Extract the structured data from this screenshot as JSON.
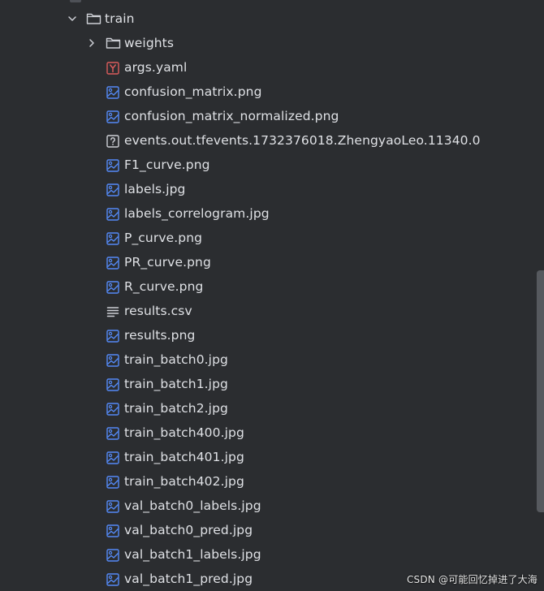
{
  "tree": {
    "root_folder": {
      "name": "train",
      "expanded": true,
      "icon": "folder-icon"
    },
    "children": [
      {
        "name": "weights",
        "type": "folder",
        "icon": "folder-icon",
        "collapsed": true
      },
      {
        "name": "args.yaml",
        "type": "yaml",
        "icon": "yaml-file-icon"
      },
      {
        "name": "confusion_matrix.png",
        "type": "image",
        "icon": "image-file-icon"
      },
      {
        "name": "confusion_matrix_normalized.png",
        "type": "image",
        "icon": "image-file-icon"
      },
      {
        "name": "events.out.tfevents.1732376018.ZhengyaoLeo.11340.0",
        "type": "unknown",
        "icon": "unknown-file-icon"
      },
      {
        "name": "F1_curve.png",
        "type": "image",
        "icon": "image-file-icon"
      },
      {
        "name": "labels.jpg",
        "type": "image",
        "icon": "image-file-icon"
      },
      {
        "name": "labels_correlogram.jpg",
        "type": "image",
        "icon": "image-file-icon"
      },
      {
        "name": "P_curve.png",
        "type": "image",
        "icon": "image-file-icon"
      },
      {
        "name": "PR_curve.png",
        "type": "image",
        "icon": "image-file-icon"
      },
      {
        "name": "R_curve.png",
        "type": "image",
        "icon": "image-file-icon"
      },
      {
        "name": "results.csv",
        "type": "text",
        "icon": "text-file-icon"
      },
      {
        "name": "results.png",
        "type": "image",
        "icon": "image-file-icon"
      },
      {
        "name": "train_batch0.jpg",
        "type": "image",
        "icon": "image-file-icon"
      },
      {
        "name": "train_batch1.jpg",
        "type": "image",
        "icon": "image-file-icon"
      },
      {
        "name": "train_batch2.jpg",
        "type": "image",
        "icon": "image-file-icon"
      },
      {
        "name": "train_batch400.jpg",
        "type": "image",
        "icon": "image-file-icon"
      },
      {
        "name": "train_batch401.jpg",
        "type": "image",
        "icon": "image-file-icon"
      },
      {
        "name": "train_batch402.jpg",
        "type": "image",
        "icon": "image-file-icon"
      },
      {
        "name": "val_batch0_labels.jpg",
        "type": "image",
        "icon": "image-file-icon"
      },
      {
        "name": "val_batch0_pred.jpg",
        "type": "image",
        "icon": "image-file-icon"
      },
      {
        "name": "val_batch1_labels.jpg",
        "type": "image",
        "icon": "image-file-icon"
      },
      {
        "name": "val_batch1_pred.jpg",
        "type": "image",
        "icon": "image-file-icon"
      }
    ]
  },
  "watermark": "CSDN @可能回忆掉进了大海",
  "colors": {
    "background": "#2b2d30",
    "text": "#dfe1e5",
    "image_icon": "#548af7",
    "yaml_icon": "#db5c5c",
    "folder_icon": "#ced0d6",
    "chevron": "#ced0d6",
    "scrollbar": "#56595e"
  }
}
